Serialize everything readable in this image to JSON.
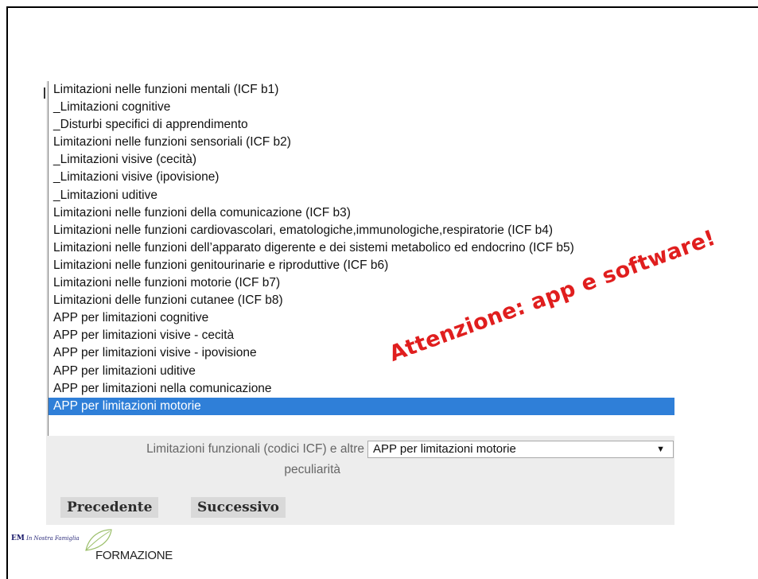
{
  "dropdown": {
    "options": [
      "Limitazioni nelle funzioni mentali (ICF b1)",
      "_Limitazioni cognitive",
      "_Disturbi specifici di apprendimento",
      "Limitazioni nelle funzioni sensoriali (ICF b2)",
      "_Limitazioni visive (cecità)",
      "_Limitazioni visive (ipovisione)",
      "_Limitazioni uditive",
      "Limitazioni nelle funzioni della comunicazione (ICF b3)",
      "Limitazioni nelle funzioni cardiovascolari, ematologiche,immunologiche,respiratorie (ICF b4)",
      "Limitazioni nelle funzioni dell’apparato digerente e dei sistemi metabolico ed endocrino (ICF b5)",
      "Limitazioni nelle funzioni genitourinarie e riproduttive (ICF b6)",
      "Limitazioni nelle funzioni motorie (ICF b7)",
      "Limitazioni delle funzioni cutanee (ICF b8)",
      "APP per limitazioni cognitive",
      "APP per limitazioni visive - cecità",
      "APP per limitazioni visive - ipovisione",
      "APP per limitazioni uditive",
      "APP per limitazioni nella comunicazione",
      "APP per limitazioni motorie"
    ],
    "selected_index": 18,
    "selected_color": "#2f7fd8"
  },
  "field": {
    "label_line1": "Limitazioni funzionali (codici ICF) e altre",
    "label_line2": "peculiarità",
    "value": "APP per limitazioni motorie",
    "chevron": "▼"
  },
  "buttons": {
    "prev": "Precedente",
    "next": "Successivo"
  },
  "annotation": {
    "text": "Attenzione: app e software!",
    "color": "#e01e1e"
  },
  "logo": {
    "small_prefix": "EM",
    "small_text": "In Nostra Famiglia",
    "text": "FORMAZIONE",
    "icon": "leaf-icon"
  }
}
